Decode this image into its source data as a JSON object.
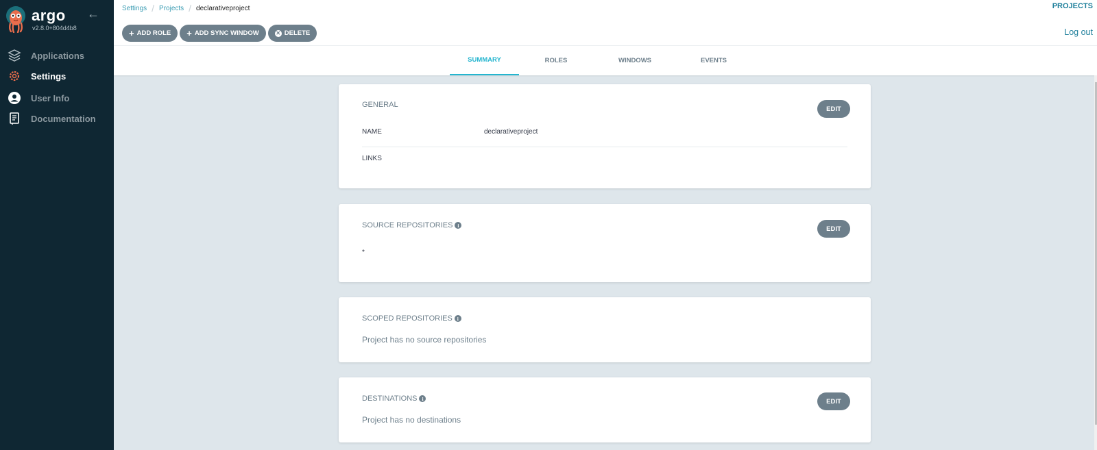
{
  "sidebar": {
    "brand": "argo",
    "version": "v2.8.0+804d4b8",
    "items": [
      {
        "label": "Applications",
        "icon": "layers-icon",
        "active": false
      },
      {
        "label": "Settings",
        "icon": "gear-icon",
        "active": true
      },
      {
        "label": "User Info",
        "icon": "user-circle-icon",
        "active": false
      },
      {
        "label": "Documentation",
        "icon": "book-icon",
        "active": false
      }
    ]
  },
  "header": {
    "breadcrumb": [
      {
        "label": "Settings",
        "link": true
      },
      {
        "label": "Projects",
        "link": true
      },
      {
        "label": "declarativeproject",
        "link": false
      }
    ],
    "page_title": "PROJECTS",
    "actions": {
      "add_role": "ADD ROLE",
      "add_sync_window": "ADD SYNC WINDOW",
      "delete": "DELETE"
    },
    "logout": "Log out"
  },
  "tabs": [
    {
      "label": "SUMMARY",
      "active": true
    },
    {
      "label": "ROLES",
      "active": false
    },
    {
      "label": "WINDOWS",
      "active": false
    },
    {
      "label": "EVENTS",
      "active": false
    }
  ],
  "cards": {
    "general": {
      "title": "GENERAL",
      "edit": "EDIT",
      "rows": [
        {
          "label": "NAME",
          "value": "declarativeproject"
        },
        {
          "label": "LINKS",
          "value": ""
        }
      ]
    },
    "source_repositories": {
      "title": "SOURCE REPOSITORIES",
      "edit": "EDIT",
      "items": [
        "*"
      ]
    },
    "scoped_repositories": {
      "title": "SCOPED REPOSITORIES",
      "empty": "Project has no source repositories"
    },
    "destinations": {
      "title": "DESTINATIONS",
      "edit": "EDIT",
      "empty": "Project has no destinations"
    }
  },
  "colors": {
    "sidebar_bg": "#0f2733",
    "accent": "#25b5cf",
    "link": "#1e7f9b",
    "button": "#6d7f8b",
    "page_bg": "#dee6eb",
    "settings_icon": "#e96d4c"
  }
}
